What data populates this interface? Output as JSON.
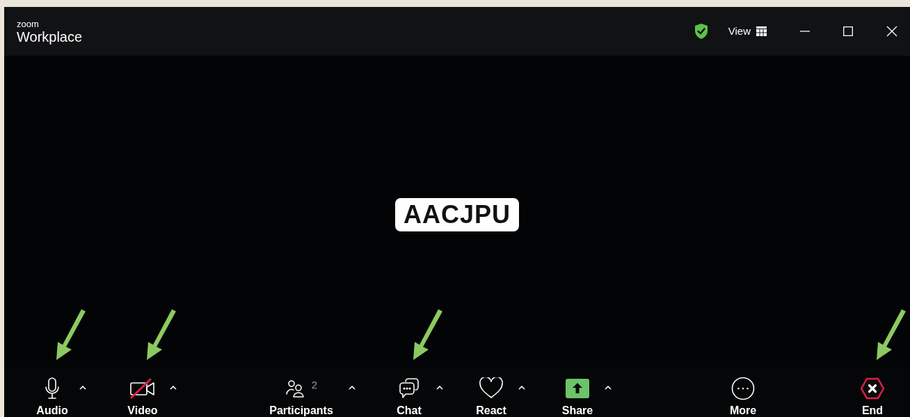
{
  "window": {
    "brand_top": "zoom",
    "brand_name": "Workplace",
    "view_label": "View"
  },
  "participant_name": "AACJPU",
  "toolbar": {
    "items": [
      {
        "kind": "mic",
        "label": "Audio",
        "off": false,
        "has_menu": true,
        "annotated": true
      },
      {
        "kind": "video",
        "label": "Video",
        "off": true,
        "has_menu": true,
        "annotated": true
      },
      {
        "kind": "participants",
        "label": "Participants",
        "count": "2",
        "has_menu": true,
        "annotated": false
      },
      {
        "kind": "chat",
        "label": "Chat",
        "has_menu": true,
        "annotated": true
      },
      {
        "kind": "react",
        "label": "React",
        "has_menu": true,
        "annotated": false
      },
      {
        "kind": "share",
        "label": "Share",
        "has_menu": true,
        "annotated": false
      },
      {
        "kind": "more",
        "label": "More",
        "has_menu": false,
        "annotated": false
      },
      {
        "kind": "end",
        "label": "End",
        "has_menu": false,
        "annotated": true
      }
    ]
  }
}
